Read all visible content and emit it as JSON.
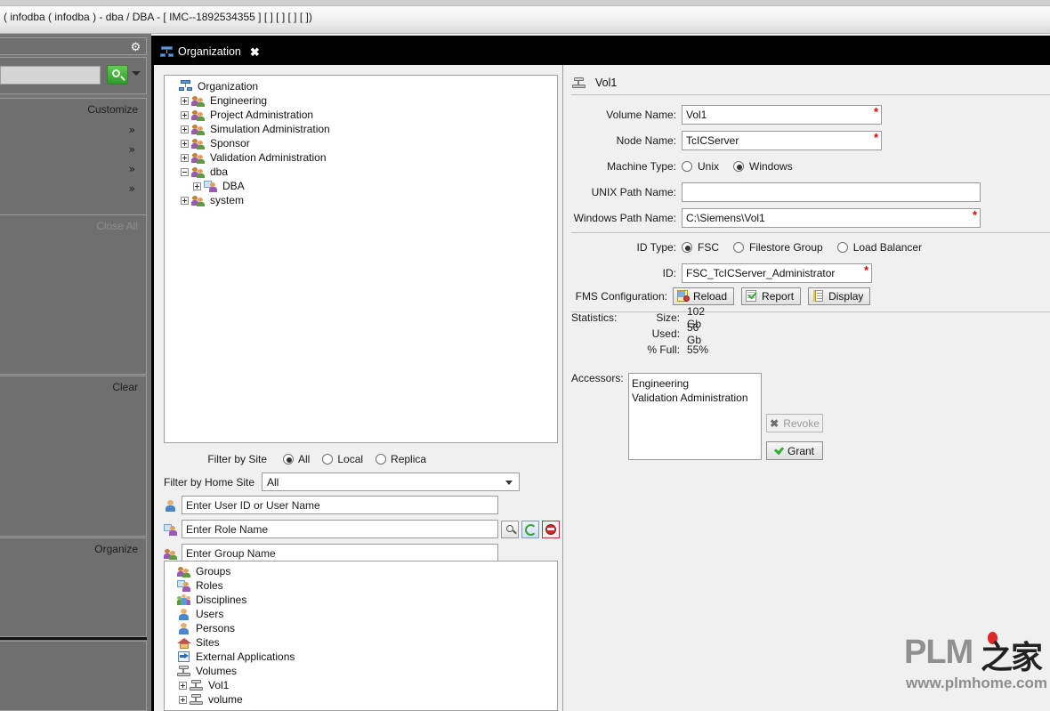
{
  "window": {
    "title": "( infodba ( infodba ) - dba / DBA - [ IMC--1892534355 ] [  ] [ ] [  ] [  ])"
  },
  "sidebar": {
    "gear_icon": "gear-icon",
    "search_placeholder": "",
    "search_button_icon": "search-icon",
    "sections": [
      {
        "label": "Customize",
        "dim": false
      },
      {
        "label": "Close All",
        "dim": true
      },
      {
        "label": "Clear",
        "dim": false
      },
      {
        "label": "Organize",
        "dim": false
      }
    ],
    "chevrons": [
      "»",
      "»",
      "»",
      "»"
    ]
  },
  "tab": {
    "label": "Organization",
    "close_label": "✖",
    "icon": "organization-icon"
  },
  "tree": {
    "nodes": [
      {
        "label": "Organization",
        "indent": 0,
        "expander": "none",
        "icon": "organization-icon"
      },
      {
        "label": "Engineering",
        "indent": 1,
        "expander": "plus",
        "icon": "group-icon"
      },
      {
        "label": "Project Administration",
        "indent": 1,
        "expander": "plus",
        "icon": "group-icon"
      },
      {
        "label": "Simulation Administration",
        "indent": 1,
        "expander": "plus",
        "icon": "group-icon"
      },
      {
        "label": "Sponsor",
        "indent": 1,
        "expander": "plus",
        "icon": "group-icon"
      },
      {
        "label": "Validation Administration",
        "indent": 1,
        "expander": "plus",
        "icon": "group-icon"
      },
      {
        "label": "dba",
        "indent": 1,
        "expander": "minus",
        "icon": "group-icon"
      },
      {
        "label": "DBA",
        "indent": 2,
        "expander": "plus",
        "icon": "role-icon"
      },
      {
        "label": "system",
        "indent": 1,
        "expander": "plus",
        "icon": "group-icon"
      }
    ]
  },
  "filters": {
    "by_site_label": "Filter by Site",
    "by_site_options": [
      "All",
      "Local",
      "Replica"
    ],
    "by_site_selected": "All",
    "by_home_site_label": "Filter by Home Site",
    "by_home_site_value": "All",
    "user_placeholder": "Enter User ID or User Name",
    "role_placeholder": "Enter Role Name",
    "group_placeholder": "Enter Group Name",
    "buttons": [
      {
        "name": "search-button",
        "icon": "magnifier-icon"
      },
      {
        "name": "refresh-button",
        "icon": "refresh-icon"
      },
      {
        "name": "stop-button",
        "icon": "stop-icon"
      }
    ]
  },
  "bottom_list": {
    "rows": [
      {
        "label": "Groups",
        "indent": 0,
        "expander": "none",
        "icon": "group-icon"
      },
      {
        "label": "Roles",
        "indent": 0,
        "expander": "none",
        "icon": "role-icon"
      },
      {
        "label": "Disciplines",
        "indent": 0,
        "expander": "none",
        "icon": "discipline-icon"
      },
      {
        "label": "Users",
        "indent": 0,
        "expander": "none",
        "icon": "user-icon"
      },
      {
        "label": "Persons",
        "indent": 0,
        "expander": "none",
        "icon": "user-icon"
      },
      {
        "label": "Sites",
        "indent": 0,
        "expander": "none",
        "icon": "site-icon"
      },
      {
        "label": "External Applications",
        "indent": 0,
        "expander": "none",
        "icon": "external-app-icon"
      },
      {
        "label": "Volumes",
        "indent": 0,
        "expander": "none",
        "icon": "volume-icon"
      },
      {
        "label": "Vol1",
        "indent": 1,
        "expander": "plus",
        "icon": "volume-icon"
      },
      {
        "label": "volume",
        "indent": 1,
        "expander": "plus",
        "icon": "volume-icon"
      }
    ]
  },
  "details": {
    "header_title": "Vol1",
    "header_icon": "volume-icon",
    "volume_name_label": "Volume Name:",
    "volume_name_value": "Vol1",
    "node_name_label": "Node Name:",
    "node_name_value": "TcICServer",
    "machine_type_label": "Machine Type:",
    "machine_type_options": [
      "Unix",
      "Windows"
    ],
    "machine_type_selected": "Windows",
    "unix_path_label": "UNIX Path Name:",
    "unix_path_value": "",
    "windows_path_label": "Windows Path Name:",
    "windows_path_value": "C:\\Siemens\\Vol1",
    "id_type_label": "ID Type:",
    "id_type_options": [
      "FSC",
      "Filestore Group",
      "Load Balancer"
    ],
    "id_type_selected": "FSC",
    "id_label": "ID:",
    "id_value": "FSC_TcICServer_Administrator",
    "fms_label": "FMS Configuration:",
    "fms_buttons": [
      {
        "label": "Reload",
        "icon": "reload-icon"
      },
      {
        "label": "Report",
        "icon": "report-icon"
      },
      {
        "label": "Display",
        "icon": "display-icon"
      }
    ],
    "statistics_label": "Statistics:",
    "size_label": "Size:",
    "size_value": "102 Gb",
    "used_label": "Used:",
    "used_value": "56 Gb",
    "pct_full_label": "% Full:",
    "pct_full_value": "55%",
    "accessors_label": "Accessors:",
    "accessors": [
      "Engineering",
      "Validation Administration"
    ],
    "revoke_label": "Revoke",
    "revoke_icon": "x-icon",
    "grant_label": "Grant",
    "grant_icon": "check-icon",
    "required_marker": "*"
  },
  "watermark": {
    "brand": "PLM",
    "brand_cn": "之家",
    "url": "www.plmhome.com"
  },
  "colors": {
    "required": "#e00000",
    "accent_green": "#2fae2f",
    "sidebar_bg": "#767676",
    "panel_bg": "#f0f0f0"
  }
}
